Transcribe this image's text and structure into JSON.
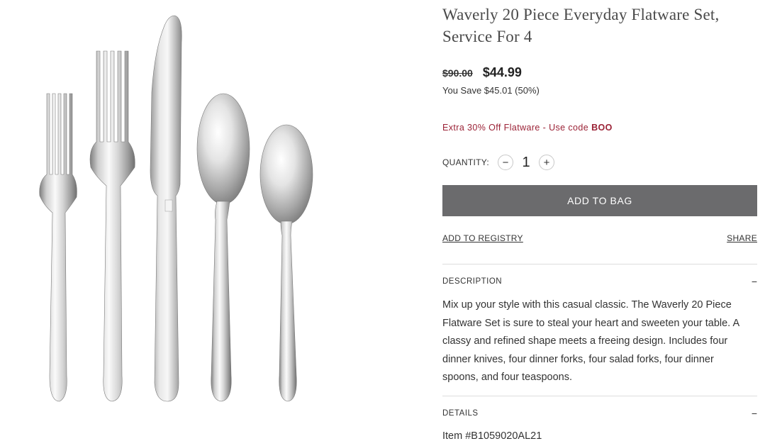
{
  "product": {
    "title": "Waverly 20 Piece Everyday Flatware Set, Service For 4",
    "image_alt": "Waverly flatware set: salad fork, dinner fork, dinner knife, dinner spoon, teaspoon"
  },
  "price": {
    "original": "$90.00",
    "current": "$44.99",
    "you_save": "You Save $45.01 (50%)"
  },
  "promo": {
    "text": "Extra 30% Off Flatware - Use code",
    "code": "BOO"
  },
  "quantity": {
    "label": "QUANTITY:",
    "value": "1",
    "minus_symbol": "−",
    "plus_symbol": "+"
  },
  "actions": {
    "add_to_bag": "ADD TO BAG",
    "add_to_registry": "ADD TO REGISTRY",
    "share": "SHARE"
  },
  "sections": {
    "description": {
      "title": "DESCRIPTION",
      "toggle": "−",
      "body": "Mix up your style with this casual classic. The Waverly 20 Piece Flatware Set is sure to steal your heart and sweeten your table. A classy and refined shape meets a freeing design. Includes four dinner knives, four dinner forks, four salad forks, four dinner spoons, and four teaspoons."
    },
    "details": {
      "title": "DETAILS",
      "toggle": "−",
      "item_number": "Item #B1059020AL21"
    }
  },
  "colors": {
    "button_bg": "#6b6b6d",
    "promo": "#9b2236",
    "divider": "#dddddd",
    "steel_light": "#f4f4f4",
    "steel_dark": "#8d8d8d"
  }
}
